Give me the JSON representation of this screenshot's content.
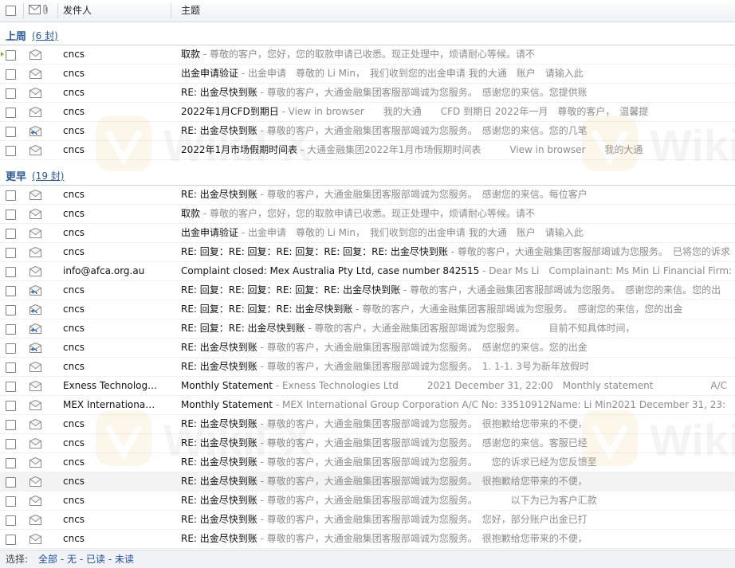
{
  "header": {
    "sender_label": "发件人",
    "subject_label": "主题"
  },
  "groups": [
    {
      "title": "上周",
      "count": "(6 封)",
      "rows": [
        {
          "sender": "cncs",
          "subject": "取款",
          "preview": "尊敬的客户，您好，您的取款申请已收悉。现正处理中，烦请耐心等候。请不",
          "icon": "envelope-icon",
          "marker": true
        },
        {
          "sender": "cncs",
          "subject": "出金申请验证",
          "preview": "出金申请　尊敬的 Li Min，　我们收到您的出金申请 我的大通　账户　请输入此",
          "icon": "envelope-icon"
        },
        {
          "sender": "cncs",
          "subject": "RE: 出金尽快到账",
          "preview": "尊敬的客户，大通金融集团客服部竭诚为您服务。　感谢您的来信。您提供账",
          "icon": "envelope-icon"
        },
        {
          "sender": "cncs",
          "subject": "2022年1月CFD到期日",
          "preview": "View in browser　　我的大通　　CFD 到期日 2022年一月　尊敬的客户，　温馨提",
          "icon": "envelope-icon"
        },
        {
          "sender": "cncs",
          "subject": "RE: 出金尽快到账",
          "preview": "尊敬的客户，大通金融集团客服部竭诚为您服务。　感谢您的来信。您的几笔",
          "icon": "reply-icon"
        },
        {
          "sender": "cncs",
          "subject": "2022年1月市场假期时间表",
          "preview": "大通金融集团2022年1月市场假期时间表　　　View in browser　　我的大通",
          "icon": "envelope-icon"
        }
      ]
    },
    {
      "title": "更早",
      "count": "(19 封)",
      "rows": [
        {
          "sender": "cncs",
          "subject": "RE: 出金尽快到账",
          "preview": "尊敬的客户，大通金融集团客服部竭诚为您服务。　感谢您的来信。每位客户",
          "icon": "envelope-icon"
        },
        {
          "sender": "cncs",
          "subject": "取款",
          "preview": "尊敬的客户，您好，您的取款申请已收悉。现正处理中，烦请耐心等候。请不",
          "icon": "envelope-icon"
        },
        {
          "sender": "cncs",
          "subject": "出金申请验证",
          "preview": "出金申请　尊敬的 Li Min，　我们收到您的出金申请 我的大通　账户　请输入此",
          "icon": "envelope-icon"
        },
        {
          "sender": "cncs",
          "subject": "RE: 回复：RE: 回复：RE: 回复：RE: 回复：RE: 出金尽快到账",
          "preview": "尊敬的客户，大通金融集团客服部竭诚为您服务。　已将您的诉求",
          "icon": "envelope-icon"
        },
        {
          "sender": "info@afca.org.au",
          "subject": "Complaint closed: Mex Australia Pty Ltd, case number 842515",
          "preview": "Dear Ms Li　Complainant: Ms Min Li Financial Firm:",
          "icon": "envelope-icon"
        },
        {
          "sender": "cncs",
          "subject": "RE: 回复：RE: 回复：RE: 回复：RE: 出金尽快到账",
          "preview": "尊敬的客户，大通金融集团客服部竭诚为您服务。　感谢您的来信。您的出",
          "icon": "reply-icon"
        },
        {
          "sender": "cncs",
          "subject": "RE: 回复：RE: 回复：RE: 出金尽快到账",
          "preview": "尊敬的客户，大通金融集团客服部竭诚为您服务。　感谢您的来信，您的出金",
          "icon": "reply-icon"
        },
        {
          "sender": "cncs",
          "subject": "RE: 回复：RE: 出金尽快到账",
          "preview": "尊敬的客户，大通金融集团客服部竭诚为您服务。　　　目前不知具体时间，",
          "icon": "reply-icon"
        },
        {
          "sender": "cncs",
          "subject": "RE: 出金尽快到账",
          "preview": "尊敬的客户，大通金融集团客服部竭诚为您服务。　感谢您的来信。您的出金",
          "icon": "reply-icon"
        },
        {
          "sender": "cncs",
          "subject": "RE: 出金尽快到账",
          "preview": "尊敬的客户，大通金融集团客服部竭诚为您服务。　1. 1-1. 3号为新年放假时",
          "icon": "envelope-icon"
        },
        {
          "sender": "Exness Technolog…",
          "subject": "Monthly Statement",
          "preview": "Exness Technologies Ltd　　　2021 December 31, 22:00　Monthly statement　　　　　　A/C",
          "icon": "envelope-icon"
        },
        {
          "sender": "MEX Internationa…",
          "subject": "Monthly Statement",
          "preview": "MEX International Group Corporation A/C No: 33510912Name: Li Min2021 December 31, 23:",
          "icon": "envelope-icon"
        },
        {
          "sender": "cncs",
          "subject": "RE: 出金尽快到账",
          "preview": "尊敬的客户，大通金融集团客服部竭诚为您服务。　很抱歉给您带来的不便，",
          "icon": "envelope-icon"
        },
        {
          "sender": "cncs",
          "subject": "RE: 出金尽快到账",
          "preview": "尊敬的客户，大通金融集团客服部竭诚为您服务。　感谢您的来信。客服已经",
          "icon": "envelope-icon"
        },
        {
          "sender": "cncs",
          "subject": "RE: 出金尽快到账",
          "preview": "尊敬的客户，大通金融集团客服部竭诚为您服务。　　您的诉求已经为您反馈至",
          "icon": "envelope-icon"
        },
        {
          "sender": "cncs",
          "subject": "RE: 出金尽快到账",
          "preview": "尊敬的客户，大通金融集团客服部竭诚为您服务。　很抱歉给您带来的不便，",
          "icon": "envelope-icon",
          "hover": true
        },
        {
          "sender": "cncs",
          "subject": "RE: 出金尽快到账",
          "preview": "尊敬的客户，大通金融集团客服部竭诚为您服务。　　　　以下为已为客户汇款",
          "icon": "envelope-icon"
        },
        {
          "sender": "cncs",
          "subject": "RE: 出金尽快到账",
          "preview": "尊敬的客户，大通金融集团客服部竭诚为您服务。　您好，部分账户出金已打",
          "icon": "envelope-icon"
        },
        {
          "sender": "cncs",
          "subject": "RE: 出金尽快到账",
          "preview": "尊敬的客户，大通金融集团客服部竭诚为您服务。　很抱歉给您带来的不便，",
          "icon": "envelope-icon"
        }
      ]
    }
  ],
  "footer": {
    "select_label": "选择:",
    "options": [
      "全部",
      "无",
      "已读",
      "未读"
    ]
  },
  "watermark": "WikiFX",
  "colors": {
    "group_title": "#2a5795",
    "preview_text": "#8c8c8c",
    "new_marker": "#78b53a"
  }
}
